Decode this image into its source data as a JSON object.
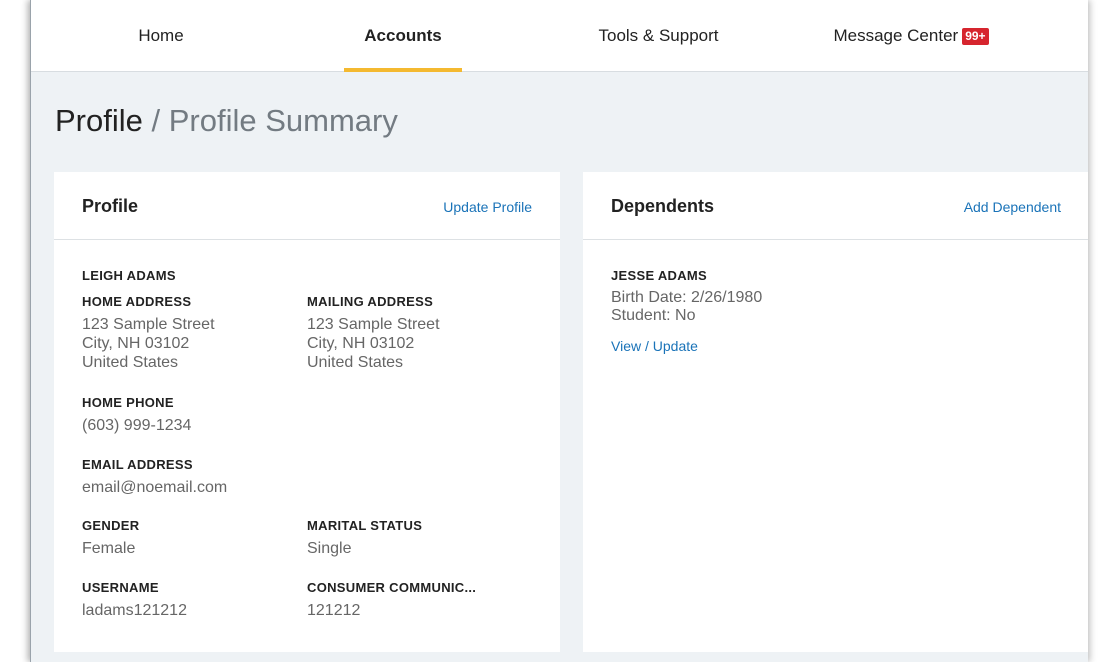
{
  "nav": {
    "home": "Home",
    "accounts": "Accounts",
    "tools": "Tools & Support",
    "message_center": "Message Center",
    "message_badge": "99+"
  },
  "breadcrumb": {
    "root": "Profile",
    "separator": " / ",
    "current": "Profile Summary"
  },
  "profile": {
    "title": "Profile",
    "update_link": "Update Profile",
    "name": "LEIGH ADAMS",
    "home_address": {
      "label": "HOME ADDRESS",
      "line1": "123 Sample Street",
      "line2": "City, NH 03102",
      "line3": "United States"
    },
    "mailing_address": {
      "label": "MAILING ADDRESS",
      "line1": "123 Sample Street",
      "line2": "City, NH 03102",
      "line3": "United States"
    },
    "home_phone": {
      "label": "HOME PHONE",
      "value": "(603) 999-1234"
    },
    "email": {
      "label": "EMAIL ADDRESS",
      "value": "email@noemail.com"
    },
    "gender": {
      "label": "GENDER",
      "value": "Female"
    },
    "marital_status": {
      "label": "MARITAL STATUS",
      "value": "Single"
    },
    "username": {
      "label": "USERNAME",
      "value": "ladams121212"
    },
    "consumer_comm": {
      "label": "CONSUMER COMMUNIC...",
      "value": "121212"
    }
  },
  "dependents": {
    "title": "Dependents",
    "add_link": "Add Dependent",
    "items": [
      {
        "name": "JESSE ADAMS",
        "birth_date": "Birth Date: 2/26/1980",
        "student": "Student: No",
        "view_link": "View / Update"
      }
    ]
  },
  "colors": {
    "accent": "#f4b930",
    "link": "#1a73b8",
    "badge": "#d6252e",
    "page_bg": "#eef2f5"
  }
}
